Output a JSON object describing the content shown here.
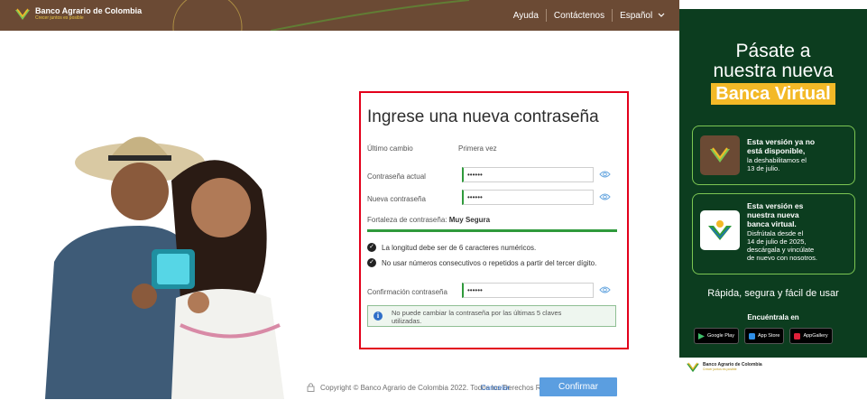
{
  "header": {
    "brand_name": "Banco Agrario de Colombia",
    "brand_slogan": "Crecer juntos es posible",
    "nav": [
      "Ayuda",
      "Contáctenos",
      "Español"
    ]
  },
  "form": {
    "title": "Ingrese una nueva contraseña",
    "last_change_label": "Último cambio",
    "last_change_value": "Primera vez",
    "current_password_label": "Contraseña actual",
    "current_password_value": "••••••",
    "new_password_label": "Nueva contraseña",
    "new_password_value": "••••••",
    "strength_label": "Fortaleza de contraseña:",
    "strength_value": "Muy Segura",
    "strength_level": 1.0,
    "rules": [
      "La longitud debe ser de 6 caracteres numéricos.",
      "No usar números consecutivos o repetidos a partir del tercer dígito."
    ],
    "confirm_label": "Confirmación contraseña",
    "confirm_value": "••••••",
    "notice_line1": "No puede cambiar la contraseña por las últimas 5 claves",
    "notice_line2": "utilizadas."
  },
  "footer": {
    "copyright": "Copyright © Banco Agrario de Colombia 2022. Todos los Derechos Reservados",
    "cancel": "Cancelar",
    "confirm": "Confirmar"
  },
  "side": {
    "title_line1": "Pásate a",
    "title_line2": "nuestra nueva",
    "title_highlight": "Banca Virtual",
    "old_bold": [
      "Esta versión ya no",
      "está disponible,"
    ],
    "old_text": [
      "la deshabilitamos el",
      "13 de julio."
    ],
    "new_bold": [
      "Esta versión es",
      "nuestra nueva",
      "banca virtual."
    ],
    "new_text": [
      "Disfrútala desde el",
      "14 de julio de 2025,",
      "descárgala y vincúlate",
      "de nuevo con nosotros."
    ],
    "tagline": "Rápida, segura y fácil de usar",
    "find_label": "Encuéntrala en",
    "stores": [
      "Google Play",
      "App Store",
      "AppGallery"
    ],
    "footer_brand": "Banco Agrario de Colombia",
    "footer_slogan": "Crecer juntos es posible"
  },
  "colors": {
    "header_bg": "#6b4a34",
    "accent_green": "#2f9a3b",
    "form_border": "#e3001b",
    "confirm_button": "#5b9ee0",
    "side_bg": "#0c3d1f",
    "highlight": "#f3b927"
  },
  "icons": [
    "brand-logo-icon",
    "eye-icon",
    "check-icon",
    "info-icon",
    "lock-icon",
    "google-play-icon",
    "app-store-icon",
    "app-gallery-icon"
  ]
}
